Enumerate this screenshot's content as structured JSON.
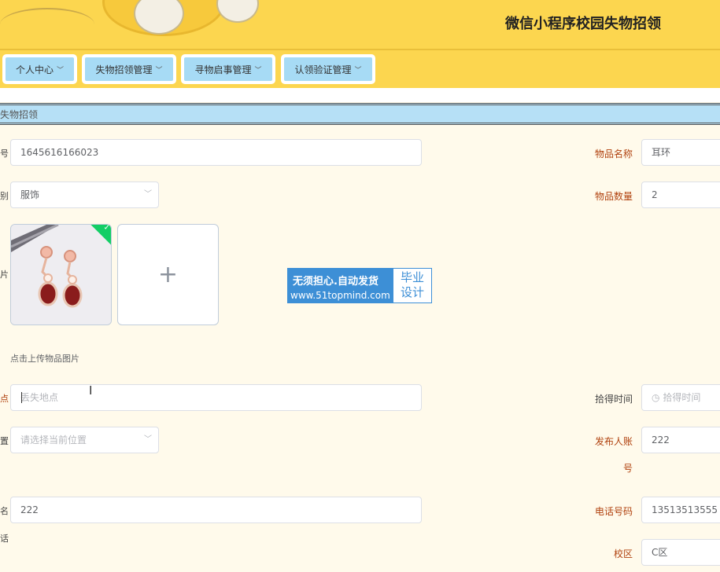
{
  "header": {
    "title": "微信小程序校园失物招领"
  },
  "nav": [
    {
      "label": "个人中心"
    },
    {
      "label": "失物招领管理"
    },
    {
      "label": "寻物启事管理"
    },
    {
      "label": "认领验证管理"
    }
  ],
  "breadcrumb": "失物招领",
  "form": {
    "number_value": "1645616166023",
    "item_name_label": "物品名称",
    "item_name_value": "耳环",
    "category_value": "服饰",
    "quantity_label": "物品数量",
    "quantity_value": "2",
    "upload_hint": "点击上传物品图片",
    "lost_place_placeholder": "丢失地点",
    "found_time_label": "拾得时间",
    "found_time_placeholder": "拾得时间",
    "location_placeholder": "请选择当前位置",
    "publisher_label_line1": "发布人账",
    "publisher_label_line2": "号",
    "publisher_value": "222",
    "contact_value": "222",
    "phone_label": "电话号码",
    "phone_value": "13513513555",
    "campus_label": "校区",
    "campus_value": "C区",
    "left_edge": [
      "号",
      "别",
      "片",
      "点",
      "置",
      "名",
      "话"
    ]
  },
  "watermark": {
    "line1": "无须担心.自动发货",
    "line2": "www.51topmind.com",
    "right_line1": "毕业",
    "right_line2": "设计"
  },
  "colors": {
    "header": "#fcd64f",
    "nav_button": "#a7dbf5",
    "breadcrumb": "#b6e0f6",
    "label_red": "#b0410e",
    "background": "#fffaeb"
  }
}
